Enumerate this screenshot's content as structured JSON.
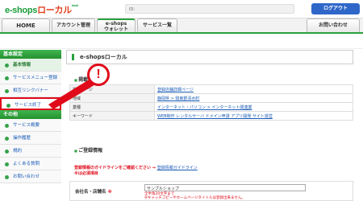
{
  "header": {
    "logo_part1": "e-shops",
    "logo_part2": "ローカル",
    "logo_part3": "local",
    "id_label": "ID：",
    "logout_label": "ログアウト"
  },
  "nav": {
    "tabs": [
      {
        "label": "HOME"
      },
      {
        "label": "アカウント管理"
      },
      {
        "label_line1": "e-shops",
        "label_line2": "ウォレット"
      },
      {
        "label": "サービス一覧"
      },
      {
        "label": "お問い合わせ"
      }
    ]
  },
  "sidebar": {
    "section1": "基本設定",
    "items1": [
      "基本情報",
      "サービスメニュー登録",
      "相互リンクバナー",
      "サービス終了"
    ],
    "section2": "その他",
    "items2": [
      "サービス概要",
      "操作履歴",
      "規約",
      "よくある質問",
      "お問い合わせ"
    ]
  },
  "alert": {
    "symbol": "!"
  },
  "main": {
    "title": "e-shopsローカル",
    "section1_head": "掲載情報",
    "rows": [
      {
        "key": "掲載ページ",
        "value": "登録店舗詳細ページ"
      },
      {
        "key": "地域",
        "value": "静岡県 > 駿東郡清水町"
      },
      {
        "key": "業種",
        "value": "インターネット・パソコン > インターネット関連業"
      },
      {
        "key": "キーワード",
        "value": "WEB制作 レンタルサーバ ドメイン申請 アプリ開発 サイト運営"
      }
    ],
    "section2_head": "ご登録情報",
    "guide_text": "登録情報のガイドラインをご確認ください ⇒ ",
    "guide_link": "登録情報ガイドライン",
    "guide_required": "※は必須項目",
    "form": {
      "label": "会社名・店舗名",
      "required_mark": "※",
      "value": "サンプルショップ",
      "help1": "全半角20文字まで",
      "help2": "※キャッチコピーやホームページタイトルは登録出来ません。"
    }
  },
  "colors": {
    "green": "#2aa23f",
    "red": "#e00a1a",
    "blue": "#2f67c9",
    "link": "#1a5bb8"
  }
}
